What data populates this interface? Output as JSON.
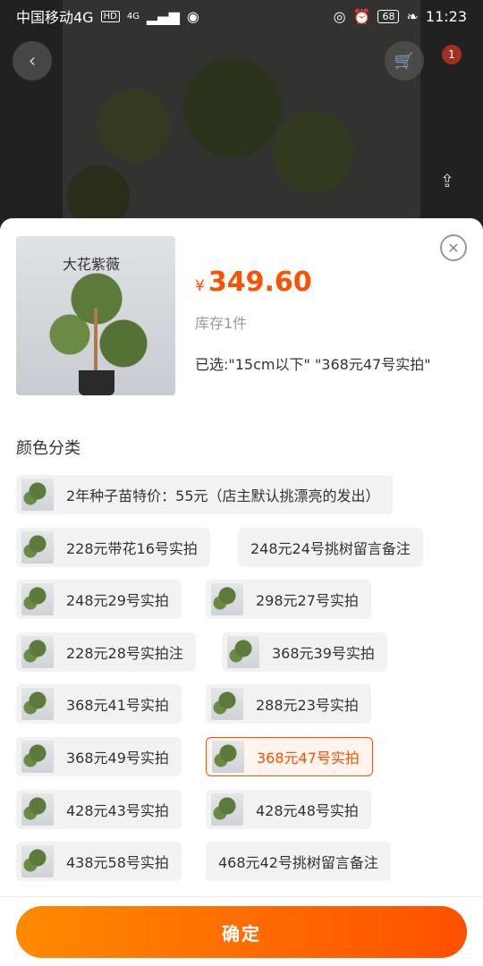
{
  "status": {
    "carrier": "中国移动4G",
    "hd": "HD",
    "net": "4G",
    "battery": "68",
    "time": "11:23"
  },
  "topbar": {
    "back_icon": "back-arrow-icon",
    "cart_icon": "cart-icon",
    "cart_badge": "1",
    "share_icon": "share-icon"
  },
  "sheet": {
    "thumb_text": "大花紫薇",
    "currency": "¥",
    "price": "349.60",
    "stock": "库存1件",
    "selected": "已选:\"15cm以下\" \"368元47号实拍\"",
    "section_title": "颜色分类",
    "options": [
      {
        "label": "2年种子苗特价：55元（店主默认挑漂亮的发出）",
        "has_img": true,
        "active": false
      },
      {
        "label": "228元带花16号实拍",
        "has_img": true,
        "active": false
      },
      {
        "label": "248元24号挑树留言备注",
        "has_img": false,
        "active": false
      },
      {
        "label": "248元29号实拍",
        "has_img": true,
        "active": false
      },
      {
        "label": "298元27号实拍",
        "has_img": true,
        "active": false
      },
      {
        "label": "228元28号实拍注",
        "has_img": true,
        "active": false
      },
      {
        "label": "368元39号实拍",
        "has_img": true,
        "active": false
      },
      {
        "label": "368元41号实拍",
        "has_img": true,
        "active": false
      },
      {
        "label": "288元23号实拍",
        "has_img": true,
        "active": false
      },
      {
        "label": "368元49号实拍",
        "has_img": true,
        "active": false
      },
      {
        "label": "368元47号实拍",
        "has_img": true,
        "active": true
      },
      {
        "label": "428元43号实拍",
        "has_img": true,
        "active": false
      },
      {
        "label": "428元48号实拍",
        "has_img": true,
        "active": false
      },
      {
        "label": "438元58号实拍",
        "has_img": true,
        "active": false
      },
      {
        "label": "468元42号挑树留言备注",
        "has_img": false,
        "active": false
      }
    ],
    "confirm_label": "确定"
  },
  "colors": {
    "accent": "#ff5000",
    "accent_gradient_start": "#ff8a00"
  }
}
